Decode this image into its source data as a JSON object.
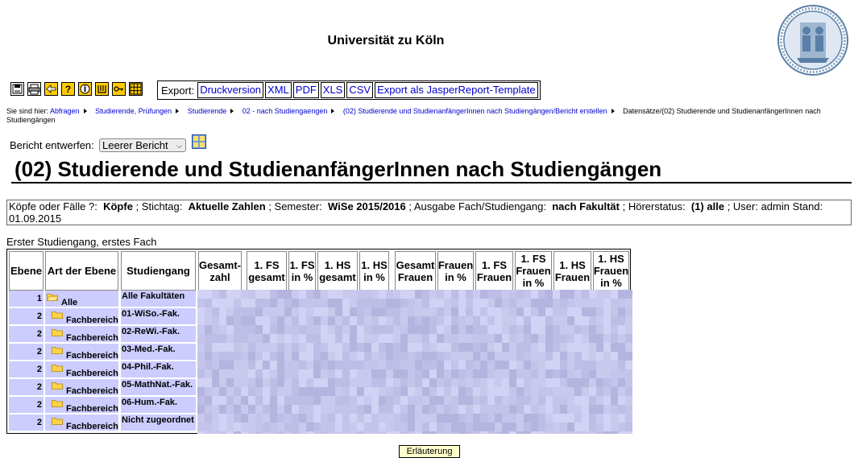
{
  "header": {
    "title": "Universität zu Köln"
  },
  "toolbar": {
    "buttons": [
      {
        "name": "save-icon"
      },
      {
        "name": "print-icon"
      },
      {
        "name": "back-icon"
      },
      {
        "name": "help-icon"
      },
      {
        "name": "info-icon"
      },
      {
        "name": "filter-icon"
      },
      {
        "name": "key-icon"
      },
      {
        "name": "table-grid-icon"
      }
    ],
    "export_label": "Export:",
    "export_links": [
      "Druckversion",
      "XML",
      "PDF",
      "XLS",
      "CSV",
      "Export als JasperReport-Template"
    ]
  },
  "breadcrumb": {
    "prefix": "Sie sind hier:",
    "links": [
      "Abfragen",
      "Studierende, Prüfungen",
      "Studierende",
      "02 - nach Studiengaengen",
      "(02) Studierende und StudienanfängerInnen nach Studiengängen/Bericht erstellen"
    ],
    "current": "Datensätze/(02) Studierende und StudienanfängerInnen nach Studiengängen"
  },
  "bericht": {
    "label": "Bericht entwerfen:",
    "selected": "Leerer Bericht"
  },
  "report": {
    "title": "(02) Studierende und StudienanfängerInnen nach Studiengängen"
  },
  "params": {
    "k1": "Köpfe oder Fälle ?:",
    "v1": "Köpfe",
    "k2": "; Stichtag:",
    "v2": "Aktuelle Zahlen",
    "k3": "; Semester:",
    "v3": "WiSe 2015/2016",
    "k4": "; Ausgabe Fach/Studiengang:",
    "v4": "nach Fakultät",
    "k5": "; Hörerstatus:",
    "v5": "(1) alle",
    "k6": "; User: admin  Stand: 01.09.2015"
  },
  "table": {
    "caption": "Erster Studiengang, erstes Fach",
    "columns": [
      "Ebene",
      "Art der Ebene",
      "Studiengang",
      "Gesamt-zahl",
      "1. FS gesamt",
      "1. FS in %",
      "1. HS gesamt",
      "1. HS in %",
      "Gesamt Frauen",
      "Frauen in %",
      "1. FS Frauen",
      "1. FS Frauen in %",
      "1. HS Frauen",
      "1. HS Frauen in %"
    ],
    "rows": [
      {
        "ebene": "1",
        "art": "Alle",
        "studiengang": "Alle Fakultäten"
      },
      {
        "ebene": "2",
        "art": "Fachbereich",
        "studiengang": "01-WiSo.-Fak."
      },
      {
        "ebene": "2",
        "art": "Fachbereich",
        "studiengang": "02-ReWi.-Fak."
      },
      {
        "ebene": "2",
        "art": "Fachbereich",
        "studiengang": "03-Med.-Fak."
      },
      {
        "ebene": "2",
        "art": "Fachbereich",
        "studiengang": "04-Phil.-Fak."
      },
      {
        "ebene": "2",
        "art": "Fachbereich",
        "studiengang": "05-MathNat.-Fak."
      },
      {
        "ebene": "2",
        "art": "Fachbereich",
        "studiengang": "06-Hum.-Fak."
      },
      {
        "ebene": "2",
        "art": "Fachbereich",
        "studiengang": "Nicht zugeordnet"
      }
    ]
  },
  "footer": {
    "button": "Erläuterung"
  },
  "colors": {
    "row_bg": "#ccccff",
    "link": "#0000cc",
    "help_bg": "#ffffcc"
  }
}
